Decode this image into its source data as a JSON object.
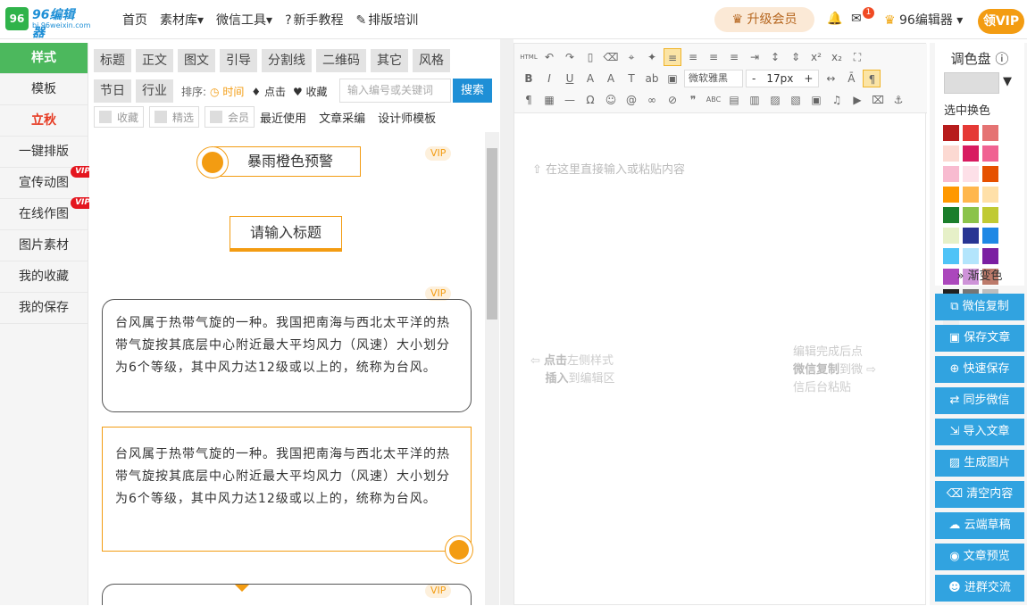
{
  "header": {
    "logo_text": "96编辑器",
    "logo_sub": "bj.96weixin.com",
    "nav": [
      "首页",
      "素材库▾",
      "微信工具▾",
      "新手教程",
      "排版培训"
    ],
    "upgrade_label": "升级会员",
    "mail_count": "1",
    "user_name": "96编辑器 ▾",
    "get_vip_label": "领VIP"
  },
  "left_nav": {
    "items": [
      "样式",
      "模板",
      "立秋",
      "一键排版",
      "宣传动图",
      "在线作图",
      "图片素材",
      "我的收藏",
      "我的保存"
    ],
    "vip_badge": "VIP"
  },
  "materials": {
    "tags_row1": [
      "标题",
      "正文",
      "图文",
      "引导",
      "分割线",
      "二维码",
      "其它",
      "风格"
    ],
    "tags_row2": [
      "节日",
      "行业"
    ],
    "sort_label": "排序:",
    "sort_options": [
      "时间",
      "点击",
      "收藏"
    ],
    "search_placeholder": "输入编号或关键词",
    "search_button": "搜索",
    "filters": [
      "收藏",
      "精选",
      "会员"
    ],
    "links": [
      "最近使用",
      "文章采编",
      "设计师模板"
    ],
    "vip_label": "VIP",
    "card_title_1": "暴雨橙色预警",
    "card_title_2": "请输入标题",
    "paragraph": "台风属于热带气旋的一种。我国把南海与西北太平洋的热带气旋按其底层中心附近最大平均风力（风速）大小划分为6个等级，其中风力达12级或以上的，统称为台风。"
  },
  "editor": {
    "font_family": "微软雅黑",
    "font_size": "17px",
    "placeholder": "在这里直接输入或粘贴内容",
    "hint_left_a": "点击",
    "hint_left_b": "左侧样式",
    "hint_left_c": "插入",
    "hint_left_d": "到编辑区",
    "hint_right_1": "编辑完成后点",
    "hint_right_2a": "微信复制",
    "hint_right_2b": "到微",
    "hint_right_3": "信后台粘贴"
  },
  "palette": {
    "title": "调色盘",
    "sub": "选中换色",
    "gradient": "渐变色",
    "colors": [
      "#b71c1c",
      "#e53935",
      "#e57373",
      "#fcd9d2",
      "#d81b60",
      "#f06292",
      "#f8bbd0",
      "#fde0e8",
      "#e65100",
      "#ff9800",
      "#ffb74d",
      "#ffe0a8",
      "#1b7e2b",
      "#8bc34a",
      "#c0ca33",
      "#e6f0c8",
      "#283593",
      "#1e88e5",
      "#4fc3f7",
      "#b3e5fc",
      "#7b1fa2",
      "#ab47bc",
      "#ce93d8",
      "#bc7a6a",
      "#212121",
      "#757575",
      "#bdbdbd",
      "#eeeeee"
    ]
  },
  "actions": [
    "微信复制",
    "保存文章",
    "快速保存",
    "同步微信",
    "导入文章",
    "生成图片",
    "清空内容",
    "云端草稿",
    "文章预览",
    "进群交流"
  ]
}
